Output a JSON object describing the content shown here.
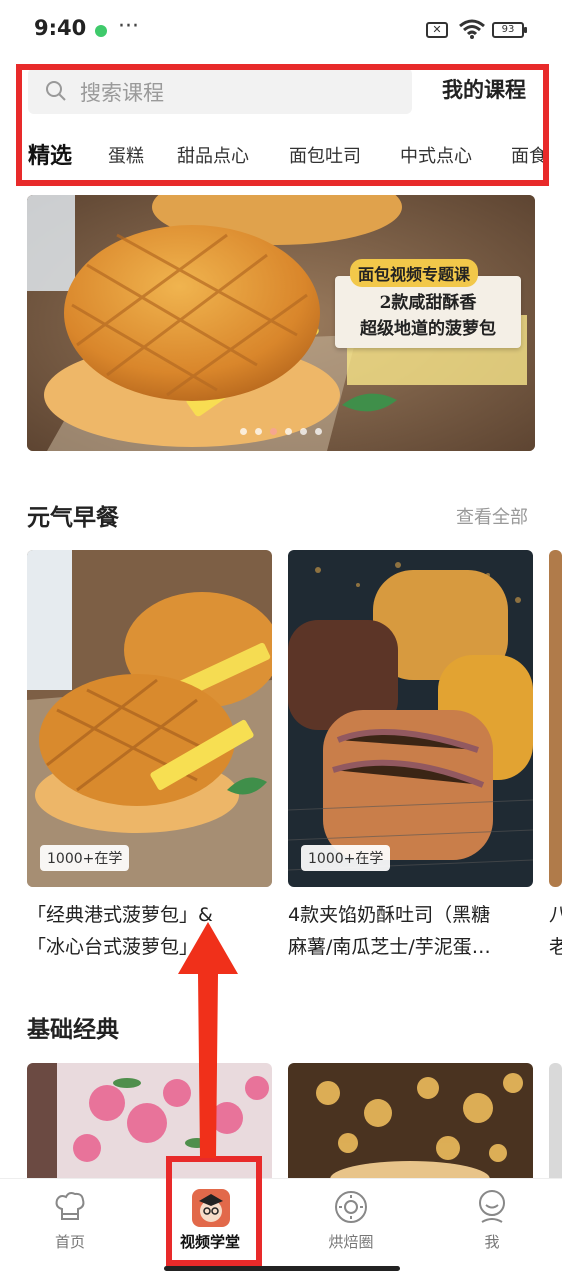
{
  "status": {
    "time": "9:40",
    "more": "···",
    "battery": "93"
  },
  "header": {
    "search_placeholder": "搜索课程",
    "my_courses": "我的课程"
  },
  "tabs": [
    "精选",
    "蛋糕",
    "甜品点心",
    "面包吐司",
    "中式点心",
    "面食"
  ],
  "banner": {
    "tag": "面包视频专题课",
    "line1": "2款咸甜酥香",
    "line2": "超级地道的菠萝包"
  },
  "section_breakfast": {
    "title": "元气早餐",
    "more": "查看全部",
    "cards": [
      {
        "badge": "1000+在学",
        "title_line1": "「经典港式菠萝包」&",
        "title_line2": "「冰心台式菠萝包」"
      },
      {
        "badge": "1000+在学",
        "title_line1": "4款夹馅奶酥吐司（黑糖",
        "title_line2": "麻薯/南瓜芝士/芋泥蛋…"
      },
      {
        "title_line1": "八",
        "title_line2": "老"
      }
    ]
  },
  "section_basic": {
    "title": "基础经典"
  },
  "tabbar": {
    "items": [
      "首页",
      "视频学堂",
      "烘焙圈",
      "我"
    ],
    "active": "视频学堂"
  },
  "colors": {
    "highlight": "#e82a2a",
    "accent": "#f2c84a"
  }
}
